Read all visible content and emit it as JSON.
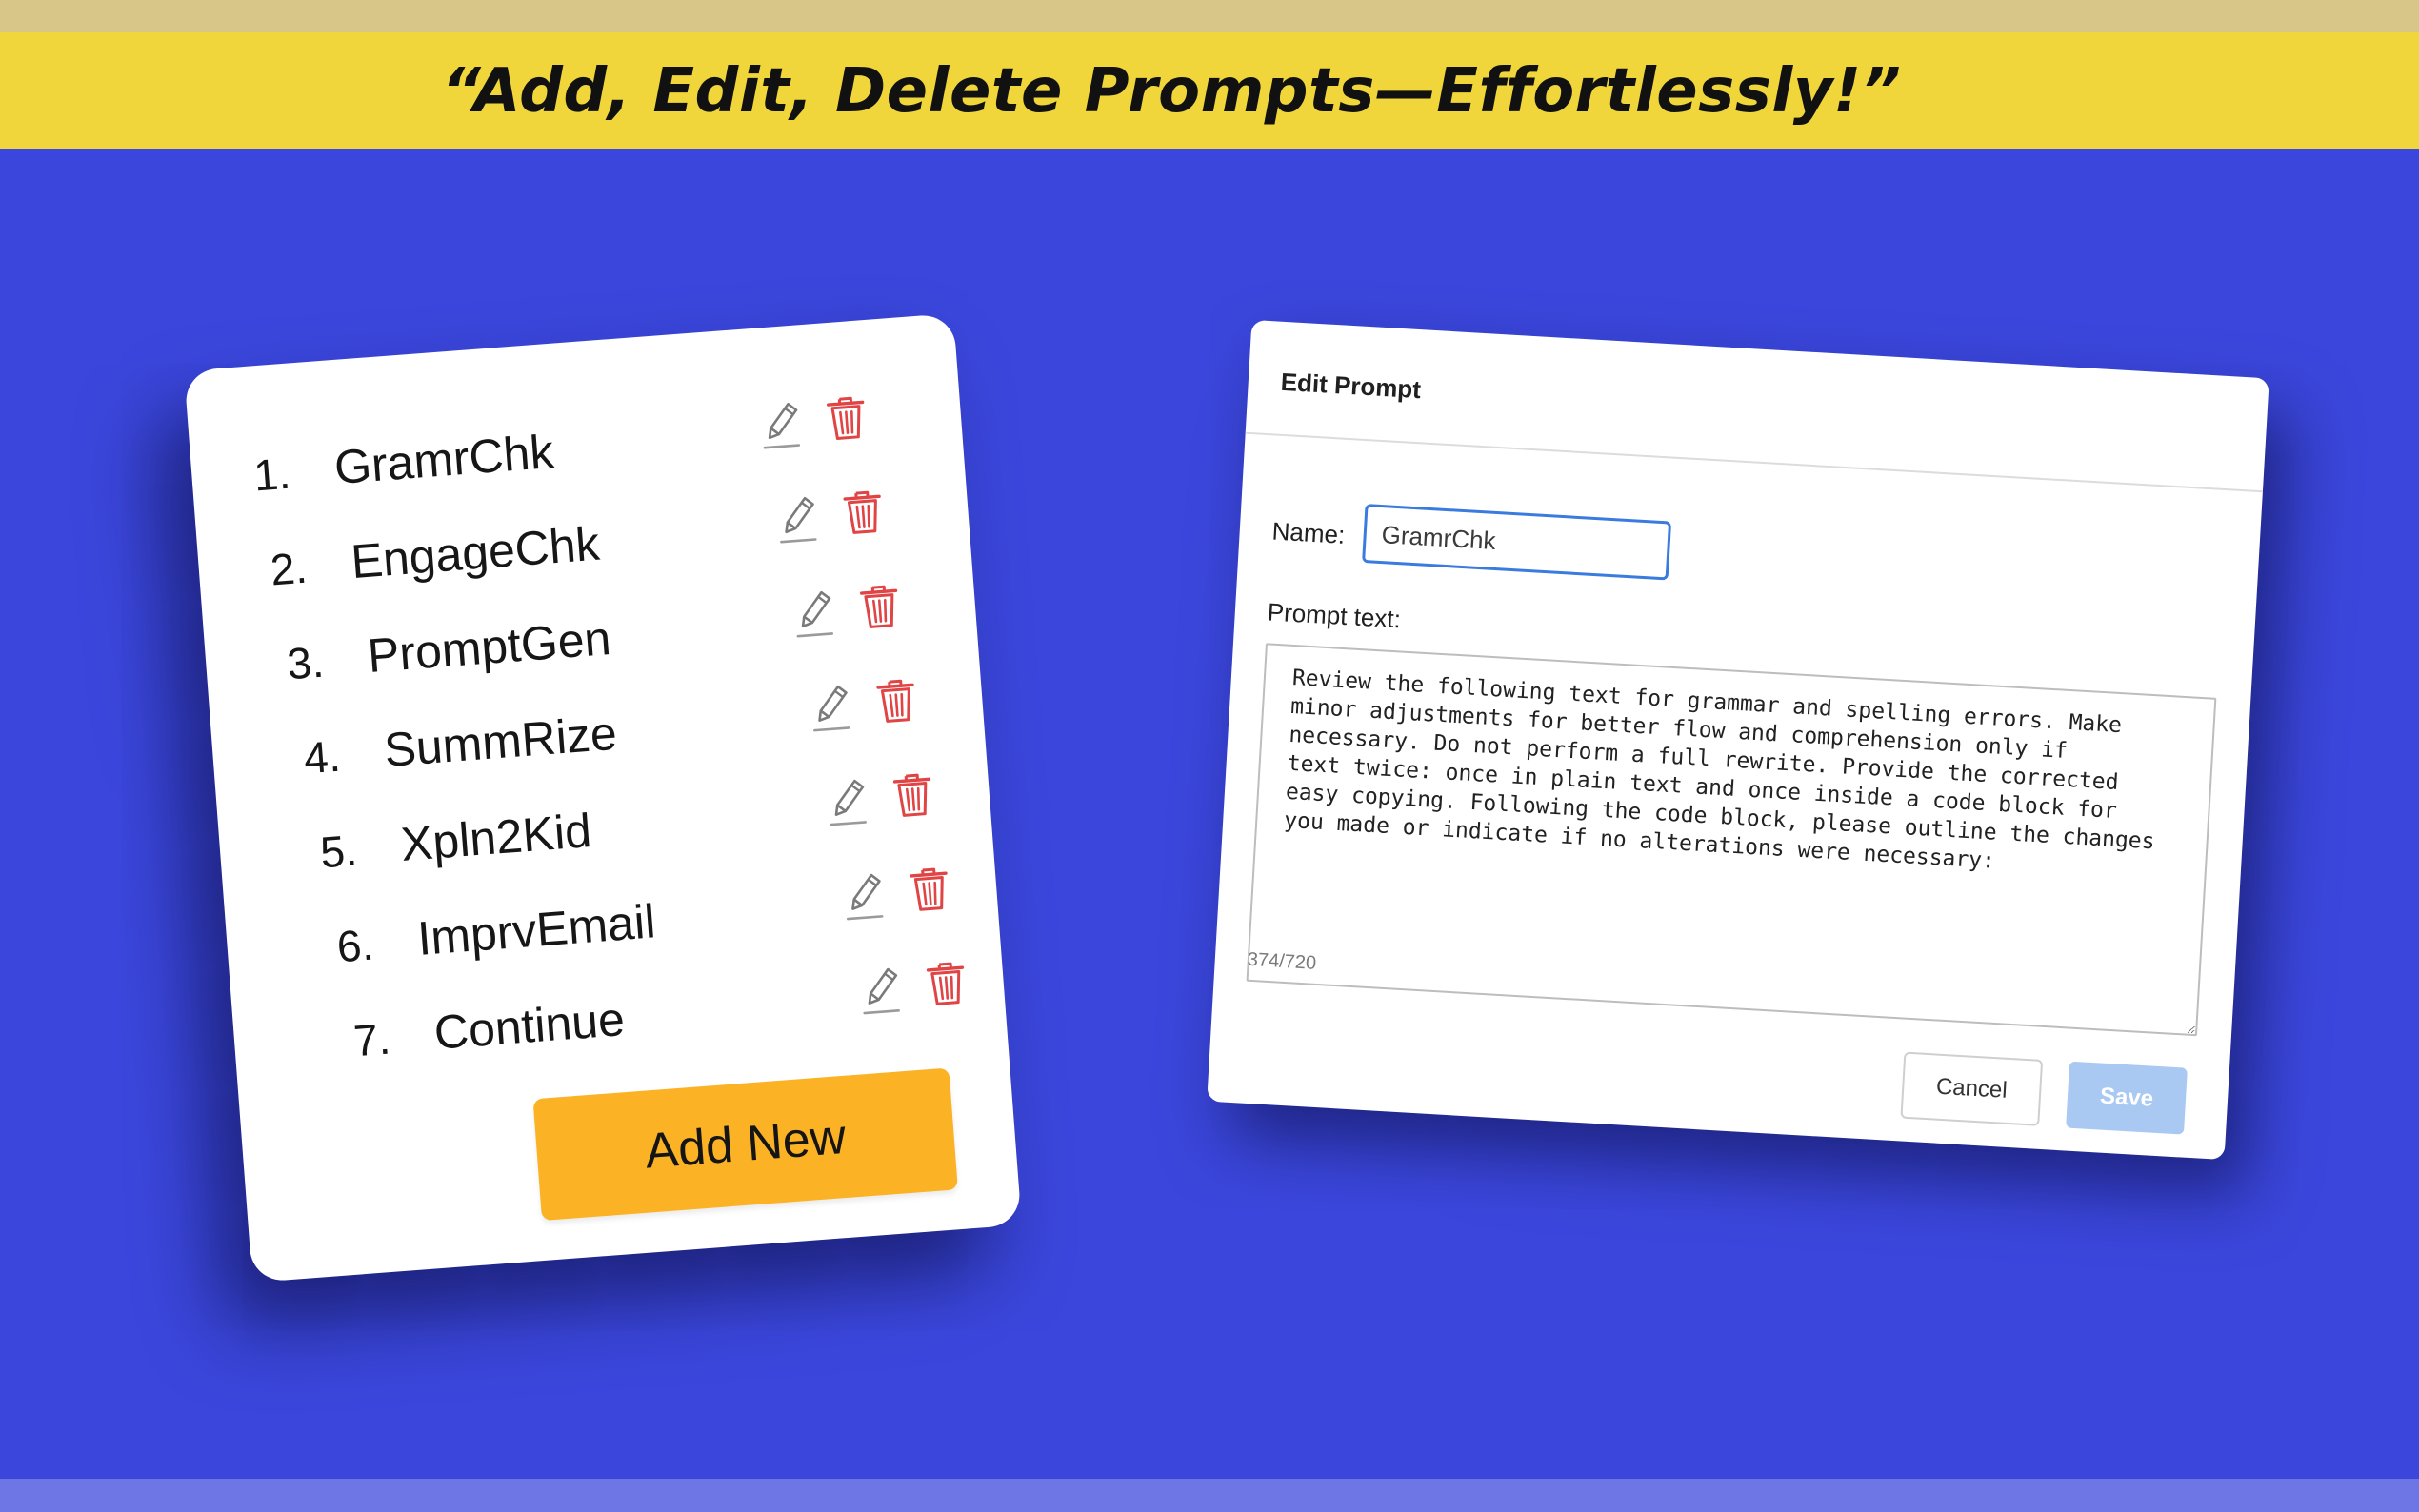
{
  "banner": {
    "headline": "“Add, Edit, Delete Prompts—Effortlessly!”"
  },
  "prompt_list": {
    "items": [
      {
        "number": "1.",
        "name": "GramrChk"
      },
      {
        "number": "2.",
        "name": "EngageChk"
      },
      {
        "number": "3.",
        "name": "PromptGen"
      },
      {
        "number": "4.",
        "name": "SummRize"
      },
      {
        "number": "5.",
        "name": "Xpln2Kid"
      },
      {
        "number": "6.",
        "name": "ImprvEmail"
      },
      {
        "number": "7.",
        "name": "Continue"
      }
    ],
    "add_new_label": "Add New",
    "edit_icon": "pencil-icon",
    "delete_icon": "trash-icon"
  },
  "edit_dialog": {
    "title": "Edit Prompt",
    "name_label": "Name:",
    "name_value": "GramrChk",
    "prompt_text_label": "Prompt text:",
    "prompt_text": "Review the following text for grammar and spelling errors. Make minor adjustments for better flow and comprehension only if necessary. Do not perform a full rewrite. Provide the corrected text twice: once in plain text and once inside a code block for easy copying. Following the code block, please outline the changes you made or indicate if no alterations were necessary:",
    "char_count": "374/720",
    "cancel_label": "Cancel",
    "save_label": "Save"
  },
  "colors": {
    "background": "#3b47dc",
    "banner": "#f0d63a",
    "add_button": "#fbb225",
    "delete_icon": "#e04444",
    "focus_border": "#3a7be0",
    "save_disabled": "#a9c9f3"
  }
}
